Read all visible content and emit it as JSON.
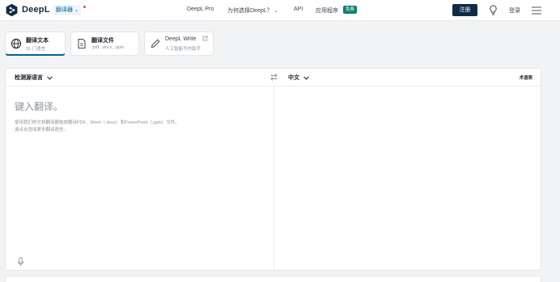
{
  "header": {
    "brand": "DeepL",
    "translator_label": "翻译器",
    "nav": [
      "DeepL Pro",
      "为何选择DeepL？",
      "API",
      "应用程序"
    ],
    "new_tag": "免费",
    "register": "注册",
    "login": "登录"
  },
  "tabs": [
    {
      "title": "翻译文本",
      "subtitle": "31 门语言"
    },
    {
      "title": "翻译文件",
      "subtitle": ".pdf, .docx, .pptx"
    },
    {
      "title": "DeepL Write",
      "subtitle": "人工智能写作助手"
    }
  ],
  "translator": {
    "source_language": "检测源语言",
    "target_language": "中文",
    "glossary": "术语表",
    "placeholder": "键入翻译。",
    "hint_line1": "使用我们的文档翻译器拖放翻译PDF、Word（.docx）和PowerPoint（.pptx）文件。",
    "hint_line2": "请点击查阅更多翻译语言。"
  },
  "colors": {
    "brand_navy": "#0f2b46",
    "accent_blue": "#006494",
    "new_green": "#0f7f70"
  }
}
